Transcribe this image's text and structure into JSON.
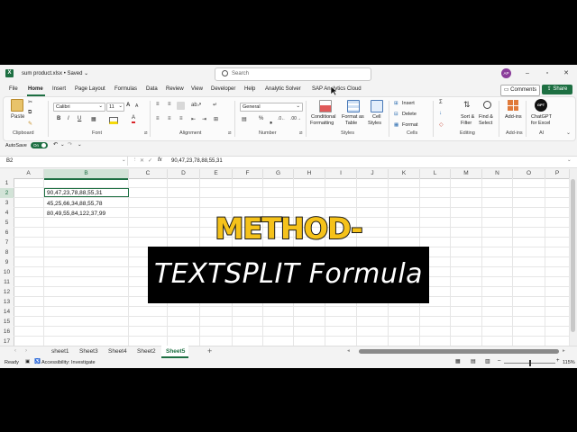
{
  "window": {
    "file_name": "sum product.xlsx",
    "saved_status": "• Saved",
    "search_placeholder": "Search",
    "user_initials": "AP"
  },
  "menu": {
    "tabs": [
      "File",
      "Home",
      "Insert",
      "Page Layout",
      "Formulas",
      "Data",
      "Review",
      "View",
      "Developer",
      "Help",
      "Analytic Solver",
      "SAP Analytics Cloud"
    ],
    "active": "Home",
    "comments_label": "Comments",
    "share_label": "Share"
  },
  "ribbon": {
    "paste_label": "Paste",
    "font_name": "Calibri",
    "font_size": "11",
    "number_format": "General",
    "groups": {
      "clipboard": "Clipboard",
      "font": "Font",
      "alignment": "Alignment",
      "number": "Number",
      "styles": "Styles",
      "cells": "Cells",
      "editing": "Editing",
      "addins": "Add-ins",
      "ai": "AI"
    },
    "styles": {
      "conditional_1": "Conditional",
      "conditional_2": "Formatting",
      "format_table_1": "Format as",
      "format_table_2": "Table",
      "cell_styles_1": "Cell",
      "cell_styles_2": "Styles"
    },
    "cells": {
      "insert": "Insert",
      "delete": "Delete",
      "format": "Format"
    },
    "editing": {
      "sort_1": "Sort &",
      "sort_2": "Filter",
      "find_1": "Find &",
      "find_2": "Select"
    },
    "addins_label": "Add-ins",
    "chatgpt_icon_text": "GPT",
    "chatgpt_1": "ChatGPT",
    "chatgpt_2": "for Excel"
  },
  "qat": {
    "autosave_label": "AutoSave",
    "toggle_state": "On"
  },
  "formula_bar": {
    "cell_ref": "B2",
    "fx": "fx",
    "formula": "90,47,23,78,88,55,31"
  },
  "grid": {
    "columns": [
      "A",
      "B",
      "C",
      "D",
      "E",
      "F",
      "G",
      "H",
      "I",
      "J",
      "K",
      "L",
      "M",
      "N",
      "O",
      "P"
    ],
    "rows": [
      "1",
      "2",
      "3",
      "4",
      "5",
      "6",
      "7",
      "8",
      "9",
      "10",
      "11",
      "12",
      "13",
      "14",
      "15",
      "16",
      "17"
    ],
    "b2": "90,47,23,78,88,55,31",
    "b3": "45,25,66,34,88,55,78",
    "b4": "80,49,55,84,122,37,99"
  },
  "sheets": {
    "items": [
      "sheet1",
      "Sheet3",
      "Sheet4",
      "Sheet2",
      "Sheet5"
    ],
    "active": "Sheet5",
    "add_label": "+"
  },
  "status": {
    "ready": "Ready",
    "accessibility": "Accessibility: Investigate",
    "zoom": "115%"
  },
  "overlay": {
    "method": "METHOD-02",
    "caption": "TEXTSPLIT Formula"
  },
  "colors": {
    "excel_green": "#1d6f42",
    "method_yellow": "#f5c21a",
    "avatar_purple": "#8a3d9a"
  }
}
